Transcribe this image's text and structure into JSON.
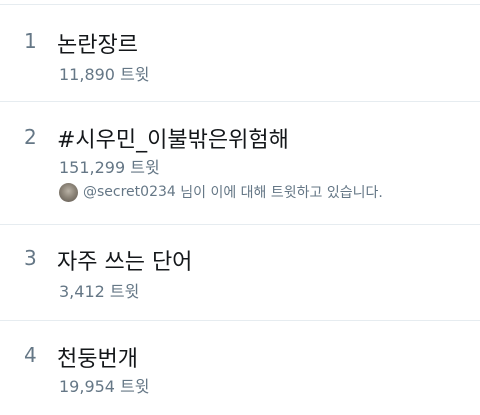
{
  "trends": [
    {
      "rank": "1",
      "title": "논란장르",
      "count": "11,890 트윗"
    },
    {
      "rank": "2",
      "title": "#시우민_이불밖은위험해",
      "count": "151,299 트윗",
      "context": {
        "handle": "@secret0234",
        "suffix": " 님이 이에 대해 트윗하고 있습니다."
      }
    },
    {
      "rank": "3",
      "title": "자주 쓰는 단어",
      "count": "3,412 트윗"
    },
    {
      "rank": "4",
      "title": "천둥번개",
      "count": "19,954 트윗"
    }
  ]
}
